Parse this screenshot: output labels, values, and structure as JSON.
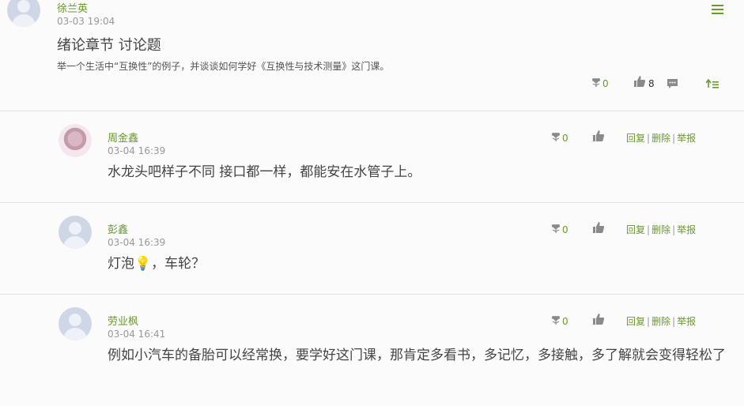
{
  "post": {
    "author": "徐兰英",
    "time": "03-03 19:04",
    "title": "绪论章节 讨论题",
    "body": "举一个生活中“互换性”的例子，并谈谈如何学好《互换性与技术测量》这门课。",
    "flower_count": "0",
    "like_count": "8",
    "icons": [
      "menu-icon",
      "flower-icon",
      "thumbs-up-icon",
      "comment-icon",
      "top-icon"
    ]
  },
  "replies": [
    {
      "author": "周金鑫",
      "time": "03-04 16:39",
      "text": "水龙头吧样子不同 接口都一样，都能安在水管子上。",
      "flower_count": "0"
    },
    {
      "author": "彭鑫",
      "time": "03-04 16:39",
      "text": "灯泡💡，车轮？",
      "flower_count": "0"
    },
    {
      "author": "劳业枫",
      "time": "03-04 16:41",
      "text": "例如小汽车的备胎可以经常换，要学好这门课，那肯定多看书，多记忆，多接触，多了解就会变得轻松了",
      "flower_count": "0"
    }
  ],
  "actions": {
    "reply": "回复",
    "delete": "删除",
    "report": "举报",
    "separator": "|"
  },
  "colors": {
    "accent": "#6a9a2a",
    "muted": "#999999",
    "icon": "#8a8a8a"
  }
}
